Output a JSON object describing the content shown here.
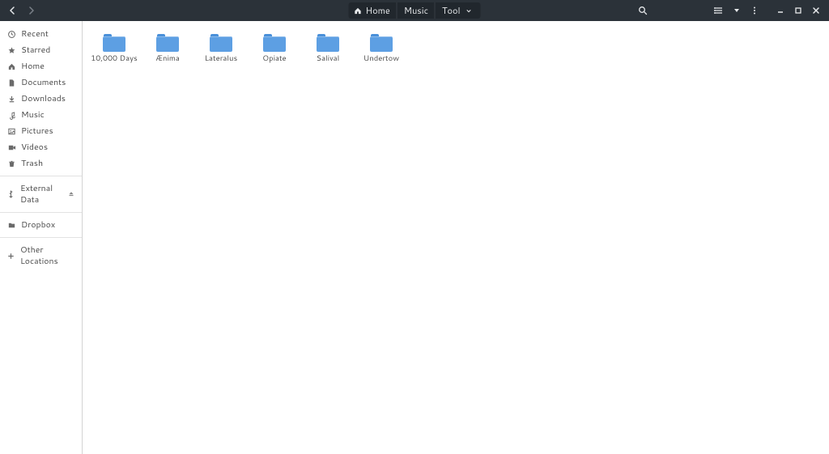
{
  "breadcrumb": [
    {
      "label": "Home",
      "icon": "home"
    },
    {
      "label": "Music",
      "icon": null
    },
    {
      "label": "Tool",
      "icon": null,
      "dropdown": true
    }
  ],
  "sidebar": {
    "places": [
      {
        "label": "Recent",
        "icon": "clock"
      },
      {
        "label": "Starred",
        "icon": "star"
      },
      {
        "label": "Home",
        "icon": "home"
      },
      {
        "label": "Documents",
        "icon": "doc"
      },
      {
        "label": "Downloads",
        "icon": "download"
      },
      {
        "label": "Music",
        "icon": "music"
      },
      {
        "label": "Pictures",
        "icon": "picture"
      },
      {
        "label": "Videos",
        "icon": "video"
      },
      {
        "label": "Trash",
        "icon": "trash"
      }
    ],
    "devices": [
      {
        "label": "External Data",
        "icon": "usb",
        "eject": true
      }
    ],
    "network": [
      {
        "label": "Dropbox",
        "icon": "folder"
      }
    ],
    "other": {
      "label": "Other Locations",
      "icon": "plus"
    }
  },
  "folders": [
    {
      "name": "10,000 Days"
    },
    {
      "name": "Ænima"
    },
    {
      "name": "Lateralus"
    },
    {
      "name": "Opiate"
    },
    {
      "name": "Salival"
    },
    {
      "name": "Undertow"
    }
  ]
}
